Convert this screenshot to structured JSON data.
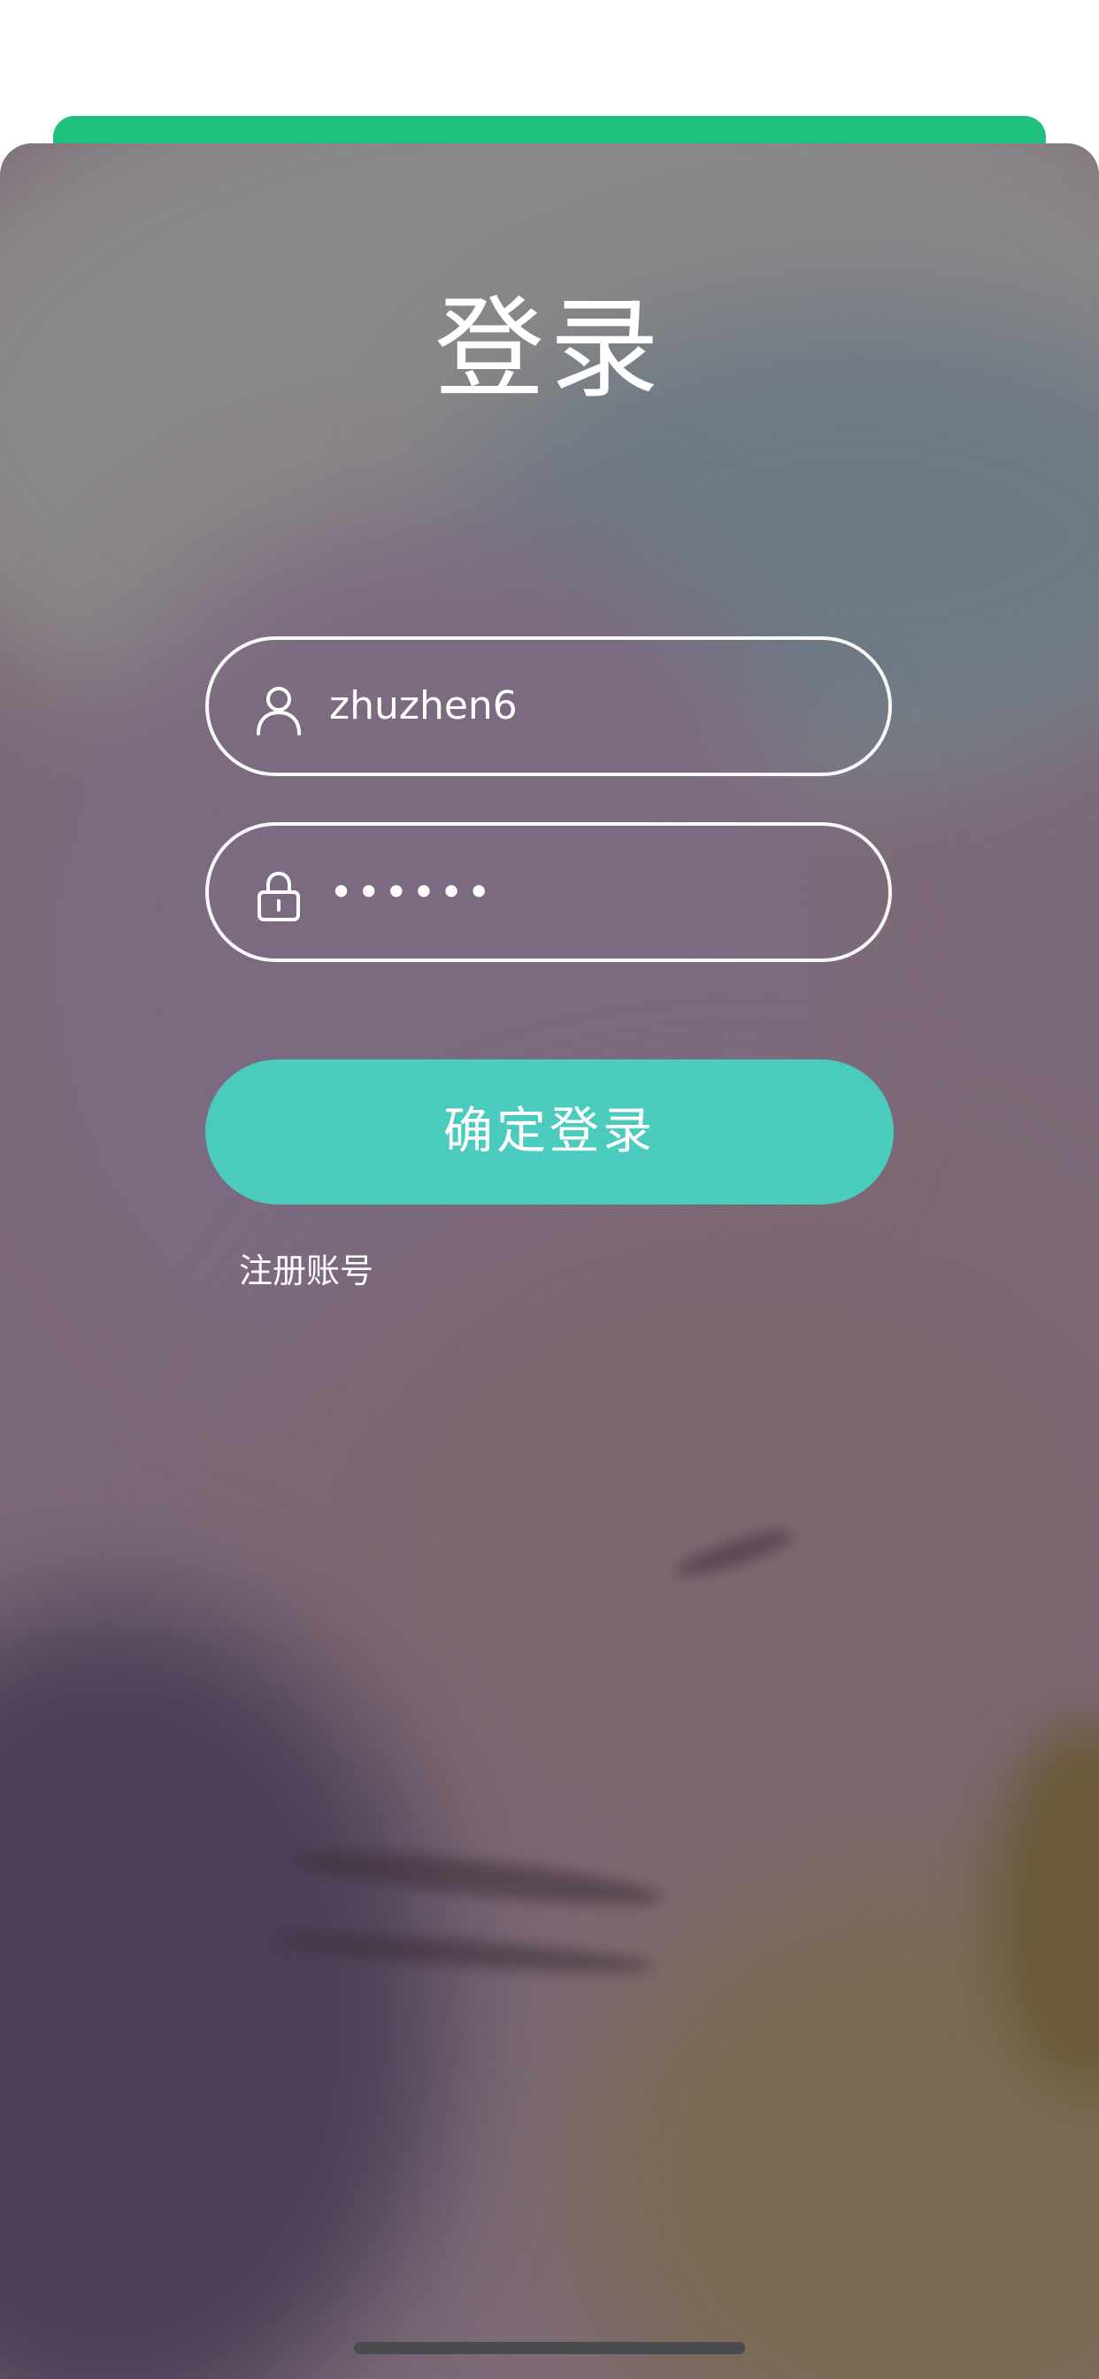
{
  "page": {
    "title": "登录"
  },
  "form": {
    "username": {
      "icon": "user-icon",
      "value": "zhuzhen6"
    },
    "password": {
      "icon": "lock-icon",
      "masked_value": "••••••"
    },
    "submit_label": "确定登录",
    "register_label": "注册账号"
  },
  "colors": {
    "header_strip": "#1ec07b",
    "button": "#4acbbd",
    "text": "#ffffff"
  }
}
